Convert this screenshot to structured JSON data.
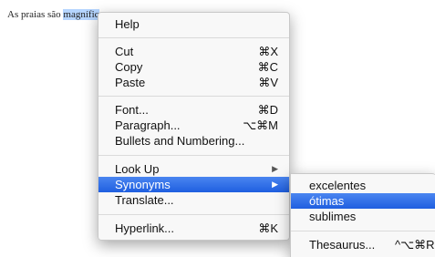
{
  "document": {
    "text_before": "As praias são ",
    "selected_word": "magnífic"
  },
  "context_menu": {
    "help": "Help",
    "cut": {
      "label": "Cut",
      "shortcut": "⌘X"
    },
    "copy": {
      "label": "Copy",
      "shortcut": "⌘C"
    },
    "paste": {
      "label": "Paste",
      "shortcut": "⌘V"
    },
    "font": {
      "label": "Font...",
      "shortcut": "⌘D"
    },
    "paragraph": {
      "label": "Paragraph...",
      "shortcut": "⌥⌘M"
    },
    "bullets": {
      "label": "Bullets and Numbering..."
    },
    "look_up": {
      "label": "Look Up",
      "arrow": "▶"
    },
    "synonyms": {
      "label": "Synonyms",
      "arrow": "▶"
    },
    "translate": {
      "label": "Translate..."
    },
    "hyperlink": {
      "label": "Hyperlink...",
      "shortcut": "⌘K"
    }
  },
  "synonyms_menu": {
    "items": [
      "excelentes",
      "ótimas",
      "sublimes"
    ],
    "highlighted_index": 1,
    "thesaurus": {
      "label": "Thesaurus...",
      "shortcut": "^⌥⌘R"
    }
  },
  "colors": {
    "highlight": "#2563e0",
    "selection": "#b5d5ff"
  }
}
